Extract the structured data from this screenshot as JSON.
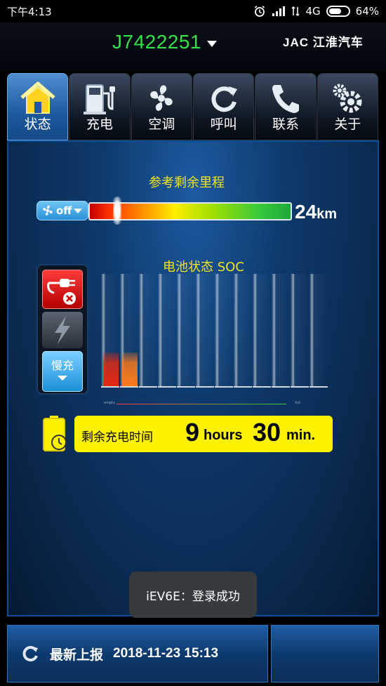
{
  "status_bar": {
    "time": "下午4:13",
    "network": "4G",
    "battery": "64%",
    "battery_level": 0.64
  },
  "header": {
    "vehicle_id": "J7422251",
    "brand": "JAC 江淮汽车"
  },
  "tabs": [
    {
      "label": "状态",
      "icon": "home-icon",
      "active": true
    },
    {
      "label": "充电",
      "icon": "charger-icon",
      "active": false
    },
    {
      "label": "空调",
      "icon": "fan-icon",
      "active": false
    },
    {
      "label": "呼叫",
      "icon": "refresh-call-icon",
      "active": false
    },
    {
      "label": "联系",
      "icon": "phone-icon",
      "active": false
    },
    {
      "label": "关于",
      "icon": "gears-icon",
      "active": false
    }
  ],
  "range": {
    "title": "参考剩余里程",
    "fan_state": "off",
    "value": "24",
    "unit": "km",
    "marker_fraction": 0.14
  },
  "soc": {
    "title": "电池状态 SOC",
    "charge_mode": "慢充",
    "empty_label": "empty",
    "full_label": "full",
    "cells_total": 12,
    "cells_filled": 2,
    "cell_colors": [
      "#e52a12",
      "#ff7a1a"
    ]
  },
  "charge_time": {
    "label": "剩余充电时间",
    "hours": "9",
    "hours_unit": "hours",
    "minutes": "30",
    "minutes_unit": "min."
  },
  "toast": {
    "text": "iEV6E：登录成功"
  },
  "footer": {
    "label": "最新上报",
    "timestamp": "2018-11-23 15:13"
  },
  "colors": {
    "vehicle_id": "#33e24a",
    "title_yellow": "#f3e320",
    "time_box": "#fff200"
  }
}
